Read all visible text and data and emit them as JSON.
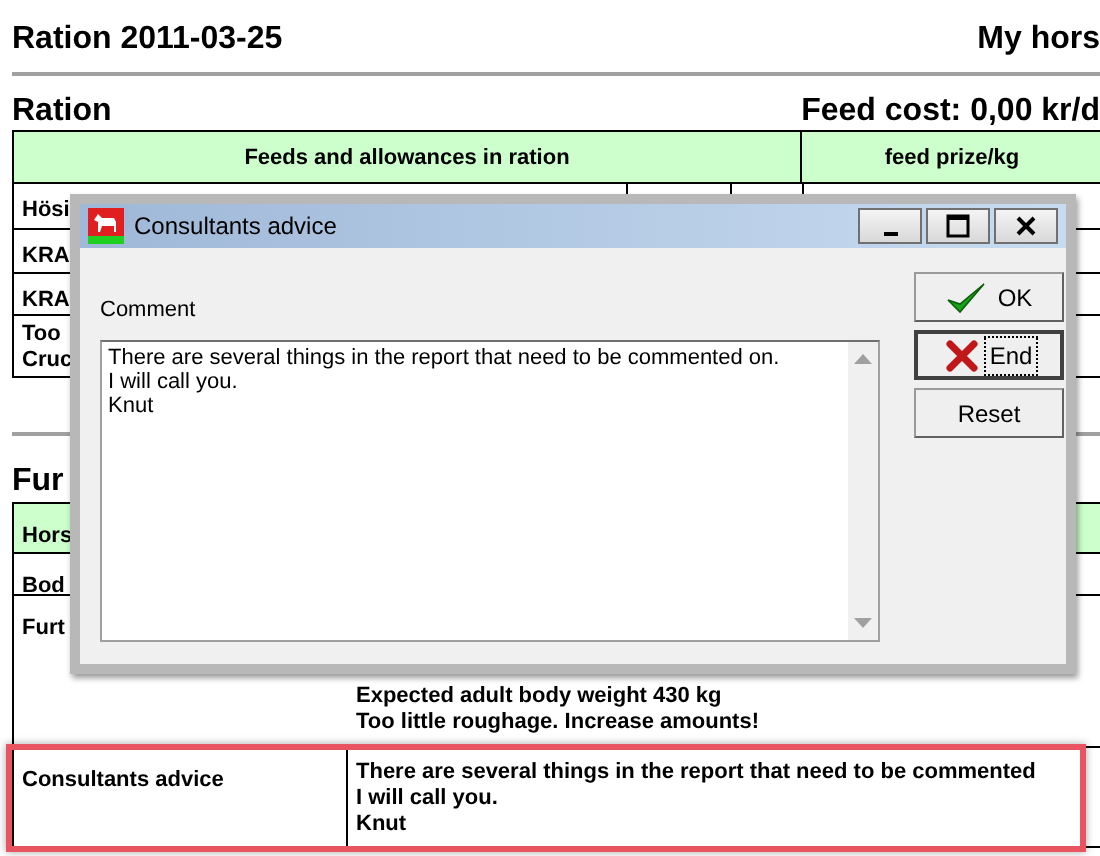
{
  "report": {
    "title": "Ration 2011-03-25",
    "horse": "My hors"
  },
  "ration": {
    "heading": "Ration",
    "feed_cost": "Feed cost: 0,00 kr/d",
    "columns": [
      "Feeds and allowances in ration",
      "feed prize/kg"
    ],
    "rows": [
      {
        "lines": [
          "Hösi"
        ]
      },
      {
        "lines": [
          "KRA"
        ]
      },
      {
        "lines": [
          "KRA"
        ]
      },
      {
        "lines": [
          "Too",
          "Cruc"
        ]
      }
    ]
  },
  "further": {
    "heading": "Fur",
    "rows": [
      {
        "label": "Hors",
        "kind": "header",
        "lines": []
      },
      {
        "label": "Bod",
        "kind": "plain",
        "lines": []
      },
      {
        "label": "Furt",
        "kind": "tall",
        "lines": [
          "Expected adult body weight 430 kg",
          "Too little roughage. Increase amounts!"
        ]
      },
      {
        "label": "Consultants advice",
        "kind": "advice",
        "highlighted": true,
        "lines": [
          "There are several things in the report that need to be commented",
          "I will call you.",
          "Knut"
        ]
      }
    ]
  },
  "dialog": {
    "title": "Consultants advice",
    "comment_label": "Comment",
    "comment": "There are several things in the report that need to be commented on.\nI will call you.\nKnut",
    "buttons": [
      {
        "label": "OK",
        "kind": "ok",
        "focused": false
      },
      {
        "label": "End",
        "kind": "end",
        "focused": true
      },
      {
        "label": "Reset",
        "kind": "reset",
        "focused": false
      }
    ]
  }
}
